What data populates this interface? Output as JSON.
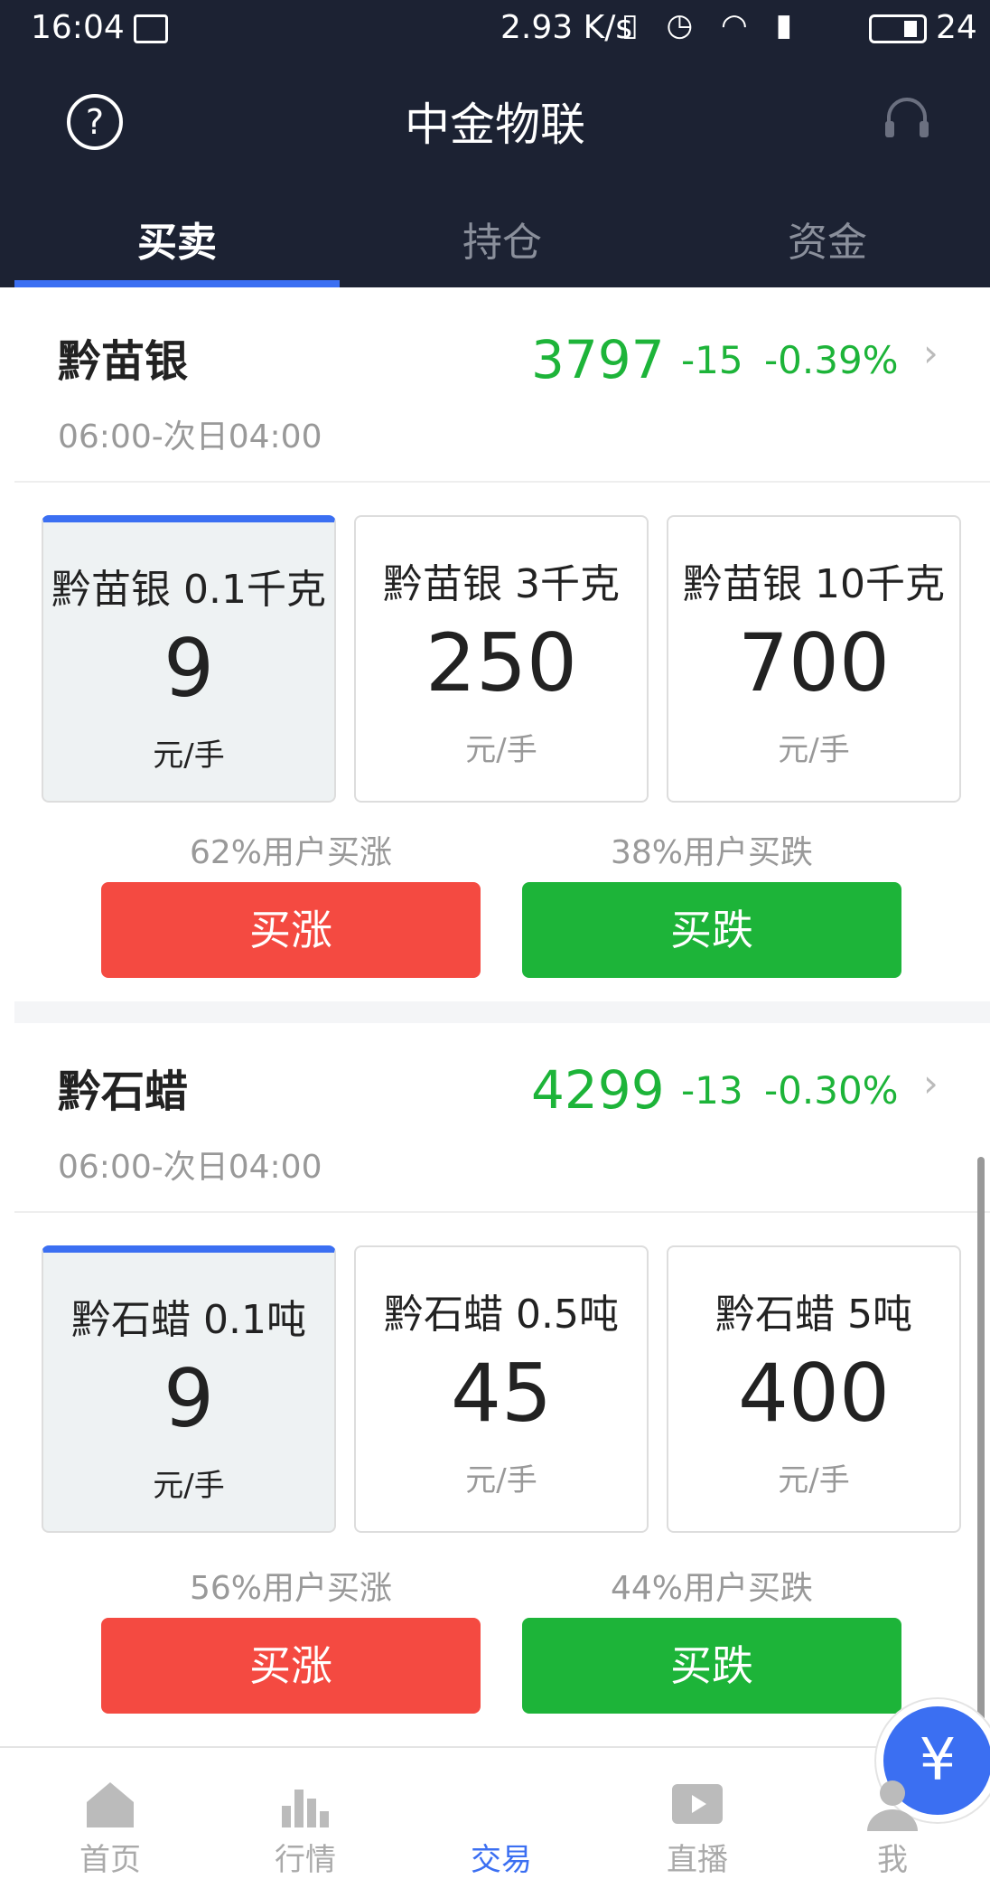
{
  "status_bar": {
    "time": "16:04",
    "speed": "2.93 K/s",
    "battery": "24"
  },
  "header": {
    "title": "中金物联"
  },
  "tabs": [
    {
      "label": "买卖",
      "active": true
    },
    {
      "label": "持仓",
      "active": false
    },
    {
      "label": "资金",
      "active": false
    }
  ],
  "products": [
    {
      "name": "黔苗银",
      "hours": "06:00-次日04:00",
      "price": "3797",
      "change": "-15",
      "change_pct": "-0.39%",
      "cards": [
        {
          "name": "黔苗银 0.1千克",
          "price": "9",
          "unit": "元/手",
          "selected": true
        },
        {
          "name": "黔苗银 3千克",
          "price": "250",
          "unit": "元/手",
          "selected": false
        },
        {
          "name": "黔苗银 10千克",
          "price": "700",
          "unit": "元/手",
          "selected": false
        }
      ],
      "up_pct": "62%用户买涨",
      "down_pct": "38%用户买跌",
      "buy_up": "买涨",
      "buy_down": "买跌"
    },
    {
      "name": "黔石蜡",
      "hours": "06:00-次日04:00",
      "price": "4299",
      "change": "-13",
      "change_pct": "-0.30%",
      "cards": [
        {
          "name": "黔石蜡 0.1吨",
          "price": "9",
          "unit": "元/手",
          "selected": true
        },
        {
          "name": "黔石蜡 0.5吨",
          "price": "45",
          "unit": "元/手",
          "selected": false
        },
        {
          "name": "黔石蜡 5吨",
          "price": "400",
          "unit": "元/手",
          "selected": false
        }
      ],
      "up_pct": "56%用户买涨",
      "down_pct": "44%用户买跌",
      "buy_up": "买涨",
      "buy_down": "买跌"
    }
  ],
  "colors": {
    "up": "#f44a41",
    "down": "#1db439",
    "accent": "#3b6ff2",
    "header_bg": "#1c2233"
  },
  "nav": [
    {
      "label": "首页",
      "icon": "home-icon"
    },
    {
      "label": "行情",
      "icon": "chart-icon"
    },
    {
      "label": "交易",
      "icon": "yen-icon",
      "active": true,
      "glyph": "¥"
    },
    {
      "label": "直播",
      "icon": "play-icon"
    },
    {
      "label": "我",
      "icon": "user-icon"
    }
  ]
}
